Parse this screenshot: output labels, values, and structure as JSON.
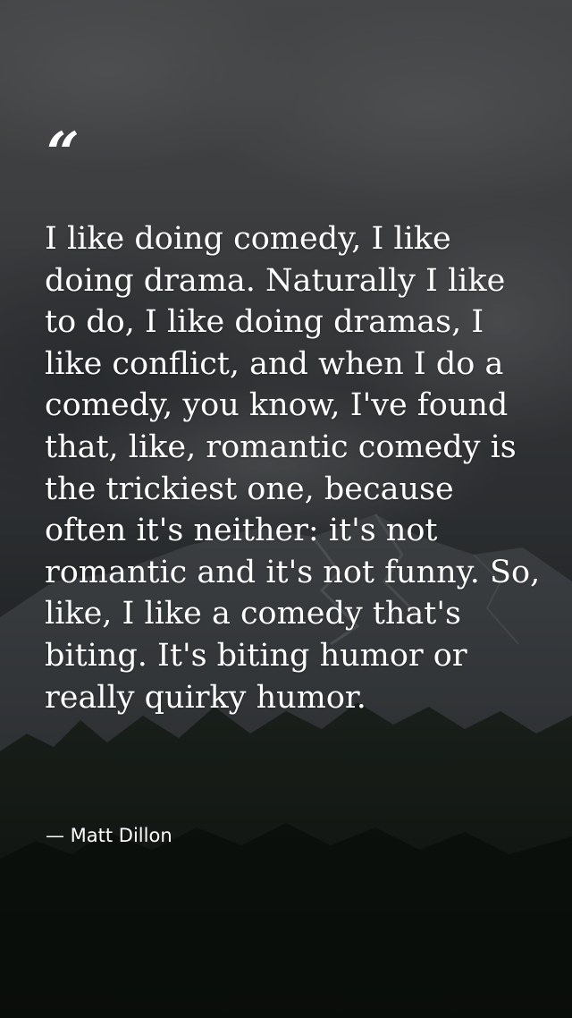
{
  "quote": {
    "mark": "“",
    "text": "I like doing comedy, I like doing drama. Naturally I like to do, I like doing dramas, I like conflict, and when I do a comedy, you know, I've found that, like, romantic comedy is the trickiest one, because often it's neither: it's not romantic and it's not funny. So, like, I like a comedy that's biting. It's biting humor or really quirky humor.",
    "author": "— Matt Dillon"
  },
  "colors": {
    "text": "#ffffff",
    "sky": "#4a4c4e",
    "mountain": "#3a3e41",
    "forest": "#141914"
  },
  "background": {
    "description_icon": "cloudy-mountain-forest-photo"
  }
}
